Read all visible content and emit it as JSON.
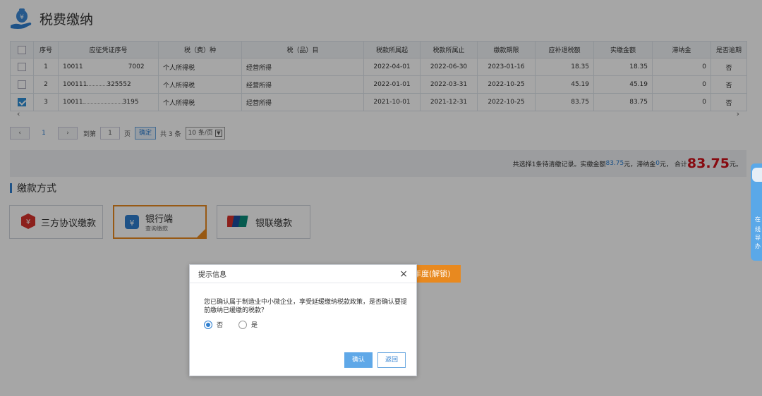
{
  "header": {
    "title": "税费缴纳",
    "logo_icon": "money-bag-hand-icon"
  },
  "table": {
    "columns": [
      "",
      "序号",
      "应征凭证序号",
      "税（费）种",
      "税（品）目",
      "税款所属起",
      "税款所属止",
      "缴款期限",
      "应补退税额",
      "实缴金额",
      "滞纳金",
      "是否逾期"
    ],
    "rows": [
      {
        "checked": false,
        "seq": "1",
        "voucher": "10011",
        "voucher_tail": "7002",
        "tax_type": "个人所得税",
        "item": "经营所得",
        "start": "2022-04-01",
        "end": "2022-06-30",
        "deadline": "2023-01-16",
        "due": "18.35",
        "paid": "18.35",
        "late_fee": "0",
        "overdue": "否"
      },
      {
        "checked": false,
        "seq": "2",
        "voucher": "100111",
        "voucher_tail": "325552",
        "tax_type": "个人所得税",
        "item": "经营所得",
        "start": "2022-01-01",
        "end": "2022-03-31",
        "deadline": "2022-10-25",
        "due": "45.19",
        "paid": "45.19",
        "late_fee": "0",
        "overdue": "否"
      },
      {
        "checked": true,
        "seq": "3",
        "voucher": "10011",
        "voucher_tail": "3195",
        "tax_type": "个人所得税",
        "item": "经营所得",
        "start": "2021-10-01",
        "end": "2021-12-31",
        "deadline": "2022-10-25",
        "due": "83.75",
        "paid": "83.75",
        "late_fee": "0",
        "overdue": "否"
      }
    ]
  },
  "scroll": {
    "left": "‹",
    "right": "›"
  },
  "pager": {
    "prev": "‹",
    "page": "1",
    "next": "›",
    "goto_label": "到第",
    "page_input": "1",
    "page_unit": "页",
    "confirm": "确定",
    "total": "共 3 条",
    "per_page": "10 条/页"
  },
  "summary": {
    "prefix": "共选择1条待清缴记录。实缴金额",
    "paid": "83.75",
    "mid1": " 元，滞纳金 ",
    "late": "0",
    "mid2": "元，  合计",
    "total": "83.75",
    "suffix": "元。"
  },
  "section": {
    "title": "缴款方式"
  },
  "pay_methods": [
    {
      "label": "三方协议缴款",
      "icon": "tripartite-agreement-icon"
    },
    {
      "label": "银行端",
      "sub": "查询缴款",
      "icon": "bank-bag-icon"
    },
    {
      "label": "银联缴款",
      "icon": "unionpay-icon"
    }
  ],
  "bg_button": {
    "label": "年度(解锁)"
  },
  "side_widget": {
    "chars": [
      "在",
      "线",
      "导",
      "办"
    ]
  },
  "dialog": {
    "title": "提示信息",
    "close": "×",
    "message": "您已确认属于制造业中小微企业，享受延缓缴纳税款政策，是否确认要提前缴纳已缓缴的税款？",
    "options": [
      "否",
      "是"
    ],
    "selected": "否",
    "ok": "确认",
    "back": "返回"
  },
  "colors": {
    "accent": "#2f7fd0",
    "total_red": "#d0101a",
    "active_orange": "#e8891f"
  }
}
